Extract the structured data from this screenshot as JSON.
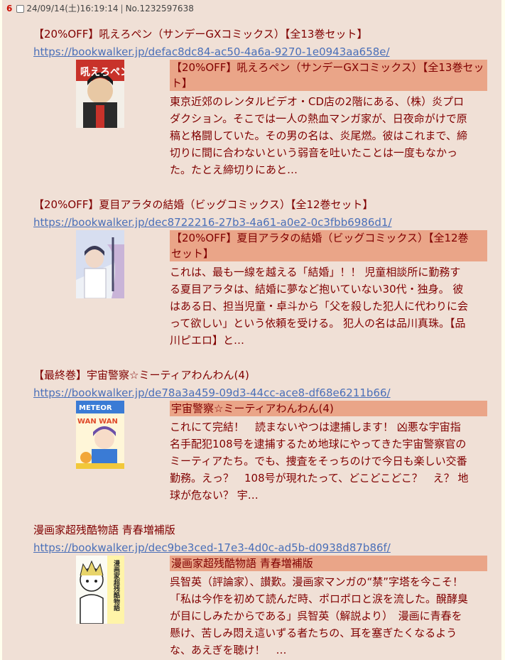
{
  "header": {
    "post_number": "6",
    "datetime": "24/09/14(土)16:19:14",
    "separator": "|",
    "post_id": "No.1232597638"
  },
  "entries": [
    {
      "title": "【20%OFF】吼えろペン（サンデーGXコミックス）【全13巻セット】",
      "url": "https://bookwalker.jp/defac8dc84-ac50-4a6a-9270-1e0943aa658e/",
      "card_title_line1": "【20%OFF】吼えろペン（サンデーGXコミックス）【全13巻セッ",
      "card_title_line2": "ト】",
      "desc_lines": [
        "東京近郊のレンタルビデオ・CD店の2階にある、（株）炎プロ",
        "ダクション。そこでは一人の熱血マンガ家が、日夜命がけで原",
        "稿と格闘していた。その男の名は、炎尾燃。彼はこれまで、締",
        "切りに間に合わないという弱音を吐いたことは一度もなかっ",
        "た。たとえ締切りにあと…"
      ]
    },
    {
      "title": "【20%OFF】夏目アラタの結婚（ビッグコミックス）【全12巻セット】",
      "url": "https://bookwalker.jp/dec8722216-27b3-4a61-a0e2-0c3fbb6986d1/",
      "card_title_line1": "【20%OFF】夏目アラタの結婚（ビッグコミックス）【全12巻",
      "card_title_line2": "セット】",
      "desc_lines": [
        "これは、最も一線を越える「結婚」！！ 児童相談所に勤務す",
        "る夏目アラタは、結婚に夢など抱いていない30代・独身。 彼",
        "はある日、担当児童・卓斗から「父を殺した犯人に代わりに会",
        "って欲しい」という依頼を受ける。 犯人の名は品川真珠。【品",
        "川ピエロ】と…"
      ]
    },
    {
      "title": "【最終巻】宇宙警察☆ミーティアわんわん(4)",
      "url": "https://bookwalker.jp/de78a3a459-09d3-44cc-ace8-df68e6211b66/",
      "card_title_line1": "宇宙警察☆ミーティアわんわん(4)",
      "card_title_line2": "",
      "desc_lines": [
        "これにて完結！　読まないやつは逮捕します！ 凶悪な宇宙指",
        "名手配犯108号を逮捕するため地球にやってきた宇宙警察官の",
        "ミーティアたち。でも、捜査をそっちのけで今日も楽しい交番",
        "勤務。えっ？　108号が現れたって、どこどこどこ？　え？ 地",
        "球が危ない？ 宇…"
      ]
    },
    {
      "title": "漫画家超残酷物語 青春増補版",
      "url": "https://bookwalker.jp/dec9be3ced-17e3-4d0c-ad5b-d0938d87b86f/",
      "card_title_line1": "漫画家超残酷物語 青春増補版",
      "card_title_line2": "",
      "desc_lines": [
        "呉智英（評論家）、讃歎。漫画家マンガの“禁”字塔を今こそ！",
        "「私は今作を初めて読んだ時、ポロポロと涙を流した。醗酵臭",
        "が目にしみたからである」呉智英（解説より）　漫画に青春を",
        "懸け、苦しみ悶え這いずる者たちの、耳を塞ぎたくなるよう",
        "な、あえぎを聴け！　…"
      ]
    }
  ],
  "thumbnails": {
    "cover1_text": "吼えろペン",
    "cover3_top_text": "METEOR",
    "cover3_mid_text": "WAN WAN",
    "cover4_text": "漫画家超残酷物語"
  }
}
